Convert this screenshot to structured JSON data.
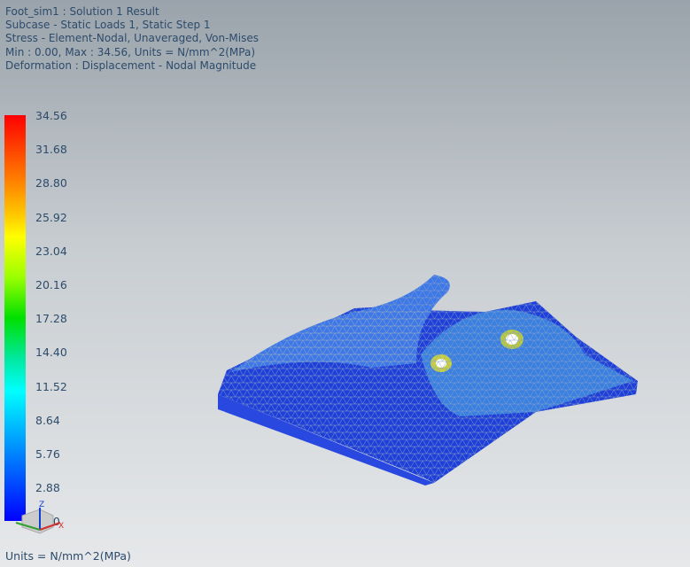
{
  "header": {
    "lines": [
      "Foot_sim1 : Solution 1 Result",
      "Subcase - Static Loads 1, Static Step 1",
      "Stress - Element-Nodal, Unaveraged, Von-Mises",
      "Min : 0.00, Max : 34.56, Units = N/mm^2(MPa)",
      "Deformation : Displacement - Nodal Magnitude"
    ]
  },
  "legend": {
    "labels": [
      "34.56",
      "31.68",
      "28.80",
      "25.92",
      "23.04",
      "20.16",
      "17.28",
      "14.40",
      "11.52",
      "8.64",
      "5.76",
      "2.88",
      "0.00"
    ],
    "min": 0.0,
    "max": 34.56
  },
  "triad": {
    "z": "Z",
    "x": "X"
  },
  "footer": {
    "units": "Units = N/mm^2(MPa)"
  }
}
